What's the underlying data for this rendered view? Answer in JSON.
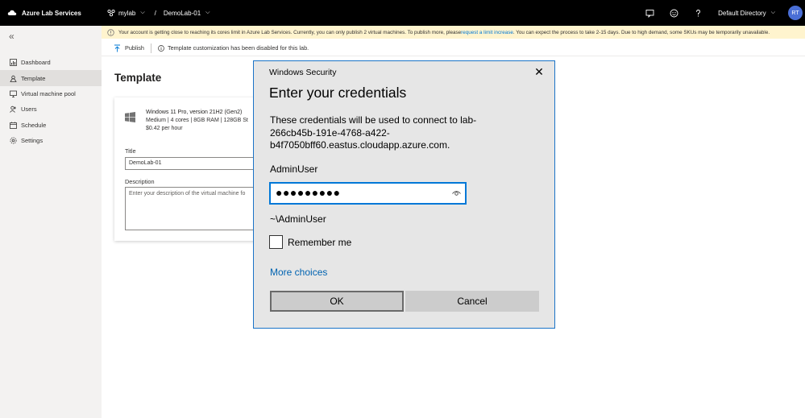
{
  "topbar": {
    "app_name": "Azure Lab Services",
    "lab_name": "mylab",
    "separator": "/",
    "lab_instance": "DemoLab-01",
    "directory": "Default Directory",
    "avatar_initials": "RT",
    "avatar_color": "#4a6fd6"
  },
  "sidebar": {
    "items": [
      {
        "label": "Dashboard",
        "icon": "dashboard-icon"
      },
      {
        "label": "Template",
        "icon": "template-icon",
        "active": true
      },
      {
        "label": "Virtual machine pool",
        "icon": "vm-pool-icon"
      },
      {
        "label": "Users",
        "icon": "users-icon"
      },
      {
        "label": "Schedule",
        "icon": "schedule-icon"
      },
      {
        "label": "Settings",
        "icon": "settings-icon"
      }
    ]
  },
  "banner": {
    "text_before": "Your account is getting close to reaching its cores limit in Azure Lab Services. Currently, you can only publish 2 virtual machines. To publish more, please ",
    "link": "request a limit increase",
    "text_after": ". You can expect the process to take 2-15 days. Due to high demand, some SKUs may be temporarily unavailable.",
    "color": "#fff4ce"
  },
  "cmdbar": {
    "publish_label": "Publish",
    "info_text": "Template customization has been disabled for this lab."
  },
  "main": {
    "title": "Template",
    "vm": {
      "name": "Windows 11 Pro, version 21H2 (Gen2)",
      "spec": "Medium | 4 cores | 8GB RAM | 128GB St",
      "price": "$0.42 per hour"
    },
    "title_label": "Title",
    "title_value": "DemoLab-01",
    "description_label": "Description",
    "description_placeholder": "Enter your description of the virtual machine fo"
  },
  "dialog": {
    "caption": "Windows Security",
    "close_glyph": "✕",
    "heading": "Enter your credentials",
    "message": "These credentials will be used to connect to lab-266cb45b-191e-4768-a422-b4f7050bff60.eastus.cloudapp.azure.com.",
    "username": "AdminUser",
    "password_mask": "●●●●●●●●●",
    "domain_user": "~\\AdminUser",
    "remember_label": "Remember me",
    "more_choices": "More choices",
    "ok_label": "OK",
    "cancel_label": "Cancel",
    "accent": "#0078d7"
  }
}
